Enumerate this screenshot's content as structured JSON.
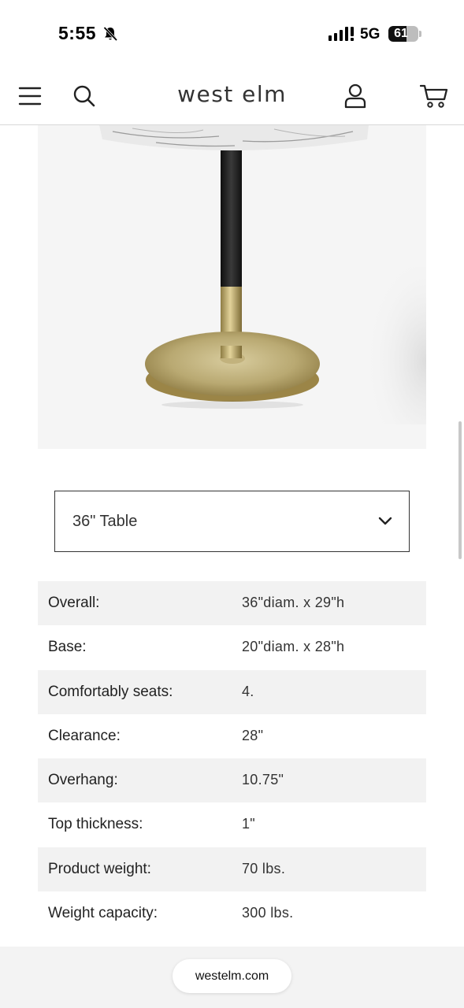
{
  "status_bar": {
    "time": "5:55",
    "network": "5G",
    "battery_percent": 61,
    "battery_label": "61",
    "icons": [
      "bell-slash-icon",
      "signal-bars-icon",
      "battery-icon"
    ]
  },
  "header": {
    "brand": "west elm",
    "icons": [
      "menu-icon",
      "search-icon",
      "account-icon",
      "cart-icon"
    ]
  },
  "product_image": {
    "alt": "Round marble top table with black and brass pedestal base"
  },
  "size_select": {
    "selected": "36\" Table",
    "icon": "chevron-down-icon"
  },
  "specs": [
    {
      "label": "Overall:",
      "value": "36\"diam. x 29\"h"
    },
    {
      "label": "Base:",
      "value": "20\"diam. x 28\"h"
    },
    {
      "label": "Comfortably seats:",
      "value": "4."
    },
    {
      "label": "Clearance:",
      "value": "28\""
    },
    {
      "label": "Overhang:",
      "value": "10.75\""
    },
    {
      "label": "Top thickness:",
      "value": "1\""
    },
    {
      "label": "Product weight:",
      "value": "70 lbs."
    },
    {
      "label": "Weight capacity:",
      "value": "300 lbs."
    }
  ],
  "browser": {
    "url": "westelm.com"
  },
  "colors": {
    "row_shade": "#f2f2f2",
    "image_bg": "#f5f5f5",
    "brass": "#b8a46a",
    "pole_black": "#1f1f1f"
  }
}
